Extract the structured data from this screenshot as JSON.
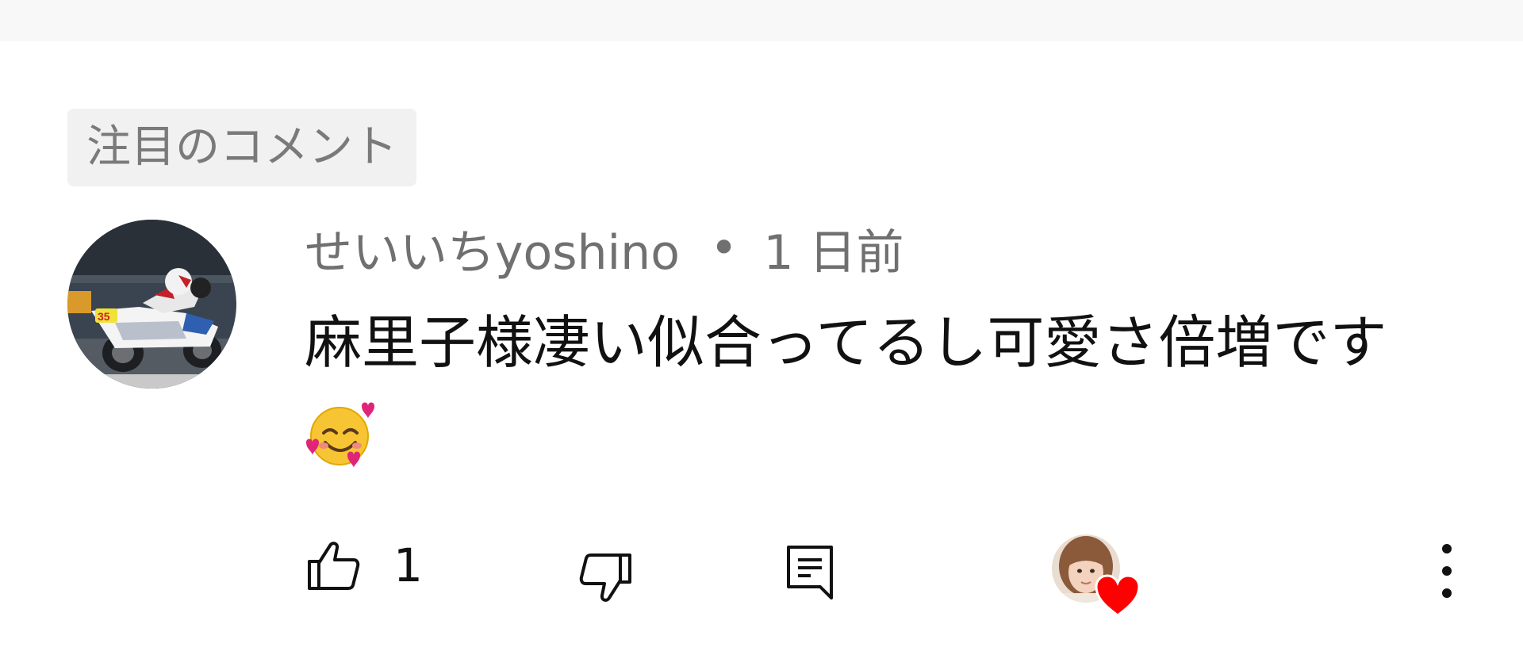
{
  "section": {
    "label": "注目のコメント"
  },
  "comment": {
    "author": "せいいちyoshino",
    "separator": "•",
    "time": "1 日前",
    "text": "麻里子様凄い似合ってるし可愛さ倍増です",
    "emoji": "smiling-face-with-hearts"
  },
  "actions": {
    "like_count": "1",
    "like_icon": "thumbs-up-icon",
    "dislike_icon": "thumbs-down-icon",
    "reply_icon": "reply-icon",
    "creator_heart_icon": "creator-heart-icon",
    "more_icon": "more-vert-icon"
  },
  "colors": {
    "heart": "#ff0000",
    "text_primary": "#111111",
    "text_secondary": "#707070",
    "chip_bg": "#f1f1f1"
  }
}
